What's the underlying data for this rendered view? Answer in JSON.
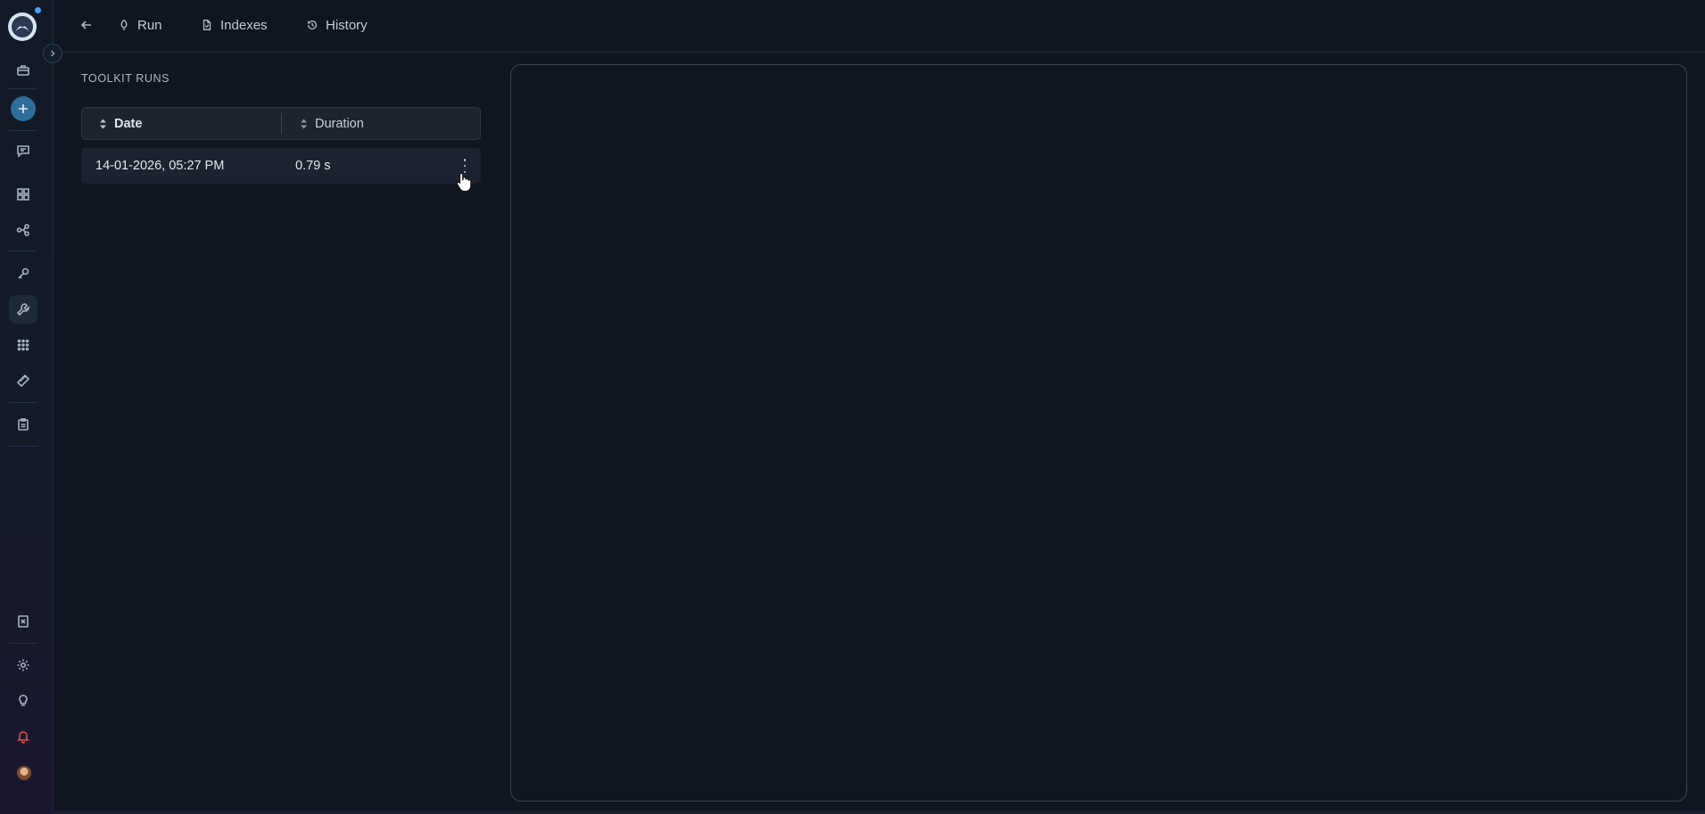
{
  "nav": {
    "back_icon": "arrow-left-icon",
    "tabs": [
      {
        "label": "Run",
        "icon": "rocket-icon"
      },
      {
        "label": "Indexes",
        "icon": "document-icon"
      },
      {
        "label": "History",
        "icon": "history-icon"
      }
    ]
  },
  "sidebar": {
    "items": [
      "briefcase-icon",
      "plus-icon",
      "chat-icon",
      "grid-icon",
      "flow-icon",
      "key-icon",
      "wrench-icon",
      "apps-icon",
      "ruler-icon",
      "clipboard-icon",
      "notes-icon",
      "gear-icon",
      "lightbulb-icon",
      "bell-icon",
      "avatar"
    ],
    "active": "wrench-icon",
    "notification_color": "#e0524d",
    "accent": "#2e6e99"
  },
  "runs": {
    "section_title": "TOOLKIT RUNS",
    "columns": {
      "date": "Date",
      "duration": "Duration"
    },
    "rows": [
      {
        "date": "14-01-2026, 05:27 PM",
        "duration": "0.79 s"
      }
    ]
  }
}
